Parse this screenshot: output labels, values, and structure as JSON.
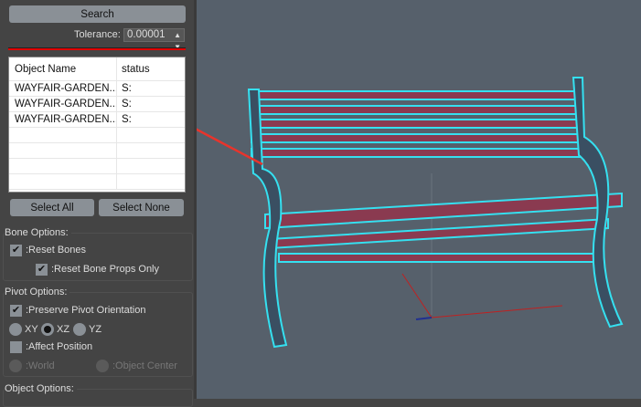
{
  "search_label": "Search",
  "tolerance": {
    "label": "Tolerance:",
    "value": "0.00001"
  },
  "list": {
    "headers": [
      "Object Name",
      "status"
    ],
    "rows": [
      [
        "WAYFAIR-GARDEN...",
        "S:"
      ],
      [
        "WAYFAIR-GARDEN...",
        "S:"
      ],
      [
        "WAYFAIR-GARDEN...",
        "S:"
      ]
    ]
  },
  "select_all": "Select All",
  "select_none": "Select None",
  "bone": {
    "title": "Bone Options:",
    "reset_bones": ":Reset Bones",
    "reset_props": ":Reset Bone Props Only"
  },
  "pivot": {
    "title": "Pivot Options:",
    "preserve": ":Preserve Pivot Orientation",
    "xy": "XY",
    "xz": "XZ",
    "yz": "YZ",
    "affect": ":Affect Position",
    "world": ":World",
    "center": ":Object Center"
  },
  "object_title": "Object Options:",
  "check": "✔",
  "colors": {
    "accent_red": "#e00000",
    "selection": "#35e0f0",
    "bench": "#8a3a50"
  }
}
